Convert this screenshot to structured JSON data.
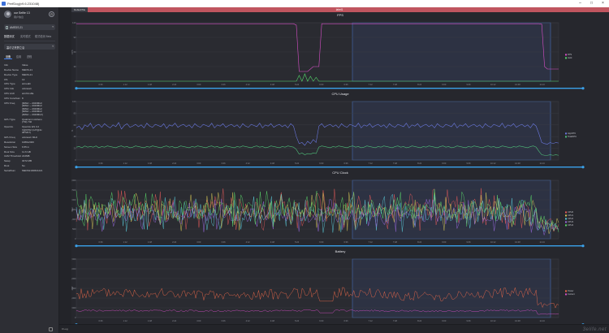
{
  "window": {
    "title": "PerfDog(v9.6.231048)"
  },
  "sidebar": {
    "username": "our Selfie 13",
    "usersub": "用户信息",
    "device": "AMEDS-21",
    "mode_tabs": [
      "数据测试",
      "实时模式",
      "模式检测 Beta"
    ],
    "app": "塞尔达荒野之息",
    "info_tabs": [
      "设备",
      "应用",
      "进程"
    ],
    "info_header": {
      "key": "Info",
      "value": "Value"
    },
    "info_rows": [
      {
        "k": "Device Name",
        "v": "MEDS-21"
      },
      {
        "k": "Device Type",
        "v": "MEDS-21"
      },
      {
        "k": "OS",
        "v": "13"
      },
      {
        "k": "CPU Type",
        "v": "armeabi"
      },
      {
        "k": "CPU Info",
        "v": "unknown"
      },
      {
        "k": "CPU Arch",
        "v": "arm64-v8a"
      },
      {
        "k": "CPU CoreNum",
        "v": "8"
      },
      {
        "k": "CPU Freq",
        "v": "[0MHz ~ 2040MHz\n[0MHz ~ 2040MHz\n[0MHz ~ 2040MHz\n[0MHz ~ 2040MHz\n[0MHz ~ 2040MHz]"
      },
      {
        "k": "GPU Type",
        "v": "Qualcomm Adreno\n(TM) 740"
      },
      {
        "k": "OpenGL",
        "v": "OpenGL ES 3.2\nV@0762 (GIT@4c\n0872b7)"
      },
      {
        "k": "GPU Freq",
        "v": "unknown MHz"
      },
      {
        "k": "Resolution",
        "v": "1080x2400"
      },
      {
        "k": "Screen Size",
        "v": "6.55 in"
      },
      {
        "k": "Root Size",
        "v": "11.6 GB"
      },
      {
        "k": "UAM Threshold",
        "v": "224MB"
      },
      {
        "k": "Swap",
        "v": "3072 MB"
      },
      {
        "k": "Root",
        "v": "No"
      },
      {
        "k": "SerialNum",
        "v": "MEDS2100821221"
      }
    ]
  },
  "main": {
    "header_left": "DefaultTile",
    "header_center": "label1"
  },
  "time_ticks": [
    "0:36",
    "1:12",
    "1:48",
    "2:24",
    "3:00",
    "3:36",
    "4:12",
    "4:48",
    "5:24",
    "6:00",
    "6:36",
    "7:12",
    "7:48",
    "8:24",
    "9:00",
    "9:36",
    "10:12",
    "10:48",
    "11:24",
    "12:00"
  ],
  "chart_data": [
    {
      "type": "line",
      "title": "FPS",
      "ylabel": "FPS",
      "ylim": [
        0,
        120
      ],
      "yticks": [
        "0",
        "30",
        "60",
        "90",
        "120"
      ],
      "grid": true,
      "legend": "right",
      "series": [
        {
          "name": "FPS",
          "color": "#d84fc8",
          "values": [
            118,
            118,
            118,
            118,
            118,
            118,
            118,
            118,
            118,
            118,
            118,
            118,
            118,
            118,
            118,
            118,
            118,
            118,
            118,
            118,
            118,
            118,
            118,
            118,
            118,
            118,
            118,
            118,
            118,
            118,
            118,
            118,
            118,
            118,
            118,
            118,
            118,
            118,
            118,
            118,
            118,
            118,
            118,
            118,
            118,
            118,
            118,
            118,
            118,
            118,
            118,
            118,
            118,
            118,
            118,
            118,
            118,
            118,
            118,
            118,
            118,
            118,
            118,
            118,
            118,
            118,
            118,
            118,
            118,
            118,
            118,
            118,
            118,
            118,
            118,
            118,
            118,
            118,
            115,
            20,
            20,
            20,
            20,
            25,
            30,
            30,
            30,
            118,
            118,
            118,
            118,
            118,
            118,
            118,
            118,
            118,
            118,
            118,
            118,
            118,
            118,
            118,
            118,
            118,
            118,
            118,
            118,
            118,
            118,
            118,
            118,
            118,
            118,
            118,
            118,
            118,
            118,
            118,
            118,
            118,
            118,
            118,
            118,
            118,
            118,
            118,
            118,
            118,
            118,
            118,
            118,
            118,
            118,
            118,
            118,
            118,
            118,
            118,
            118,
            118,
            118,
            118,
            118,
            118,
            118,
            118,
            118,
            118,
            118,
            118,
            118,
            118,
            118,
            118,
            118,
            118,
            118,
            118,
            118,
            118,
            118,
            118,
            118,
            118,
            118,
            117,
            30,
            25,
            25,
            25,
            25,
            25
          ]
        },
        {
          "name": "Jank",
          "color": "#53d66a",
          "values": [
            0,
            0,
            0,
            0,
            0,
            0,
            0,
            0,
            0,
            0,
            0,
            0,
            0,
            0,
            0,
            0,
            0,
            0,
            0,
            0,
            0,
            0,
            0,
            0,
            0,
            0,
            0,
            0,
            0,
            0,
            0,
            0,
            0,
            0,
            0,
            0,
            0,
            0,
            0,
            0,
            0,
            0,
            0,
            0,
            0,
            0,
            0,
            0,
            0,
            0,
            0,
            0,
            0,
            0,
            0,
            0,
            0,
            0,
            0,
            0,
            0,
            0,
            0,
            0,
            0,
            0,
            0,
            0,
            0,
            0,
            0,
            0,
            0,
            0,
            0,
            0,
            0,
            0,
            0,
            12,
            0,
            15,
            0,
            10,
            0,
            8,
            0,
            0,
            0,
            0,
            0,
            0,
            0,
            0,
            0,
            0,
            0,
            0,
            0,
            0,
            0,
            0,
            0,
            0,
            0,
            0,
            0,
            0,
            0,
            0,
            0,
            0,
            0,
            0,
            0,
            0,
            0,
            0,
            0,
            0,
            0,
            0,
            0,
            0,
            0,
            0,
            0,
            0,
            0,
            0,
            0,
            0,
            0,
            0,
            0,
            0,
            0,
            0,
            0,
            0,
            0,
            0,
            0,
            0,
            0,
            0,
            0,
            0,
            0,
            0,
            0,
            0,
            0,
            0,
            0,
            0,
            0,
            0,
            0,
            0,
            0,
            0,
            0,
            0,
            0,
            0,
            0,
            0,
            0,
            0,
            0,
            0
          ]
        }
      ]
    },
    {
      "type": "line",
      "title": "CPU Usage",
      "ylabel": "%",
      "ylim": [
        0,
        100
      ],
      "yticks": [
        "0",
        "20",
        "40",
        "60",
        "80",
        "100"
      ],
      "grid": true,
      "legend": "right",
      "series": [
        {
          "name": "AppCPU",
          "color": "#6a78e0",
          "values": [
            55,
            58,
            52,
            60,
            57,
            63,
            54,
            59,
            61,
            56,
            62,
            58,
            55,
            60,
            57,
            64,
            53,
            59,
            62,
            56,
            58,
            61,
            57,
            60,
            55,
            63,
            58,
            56,
            61,
            59,
            57,
            62,
            54,
            60,
            58,
            63,
            56,
            59,
            61,
            57,
            60,
            55,
            62,
            58,
            56,
            61,
            59,
            57,
            63,
            55,
            60,
            58,
            62,
            56,
            59,
            61,
            57,
            60,
            55,
            62,
            58,
            56,
            61,
            59,
            57,
            63,
            55,
            60,
            58,
            62,
            56,
            59,
            61,
            57,
            60,
            55,
            62,
            58,
            40,
            28,
            30,
            25,
            32,
            28,
            35,
            30,
            58,
            62,
            56,
            59,
            61,
            57,
            60,
            55,
            62,
            58,
            56,
            61,
            59,
            57,
            63,
            55,
            60,
            58,
            62,
            56,
            59,
            61,
            57,
            60,
            55,
            62,
            58,
            56,
            61,
            59,
            57,
            63,
            55,
            60,
            58,
            62,
            56,
            59,
            61,
            57,
            60,
            55,
            62,
            58,
            56,
            61,
            59,
            57,
            63,
            55,
            60,
            58,
            62,
            56,
            59,
            61,
            57,
            60,
            55,
            62,
            58,
            56,
            61,
            59,
            57,
            63,
            55,
            60,
            58,
            62,
            56,
            59,
            61,
            57,
            60,
            55,
            62,
            58,
            45,
            30,
            28,
            27,
            30,
            28,
            30,
            29
          ]
        },
        {
          "name": "TotalCPU",
          "color": "#4fbf7a",
          "values": [
            22,
            23,
            21,
            24,
            22,
            23,
            22,
            24,
            21,
            23,
            22,
            24,
            23,
            22,
            21,
            23,
            24,
            22,
            23,
            21,
            22,
            24,
            23,
            22,
            21,
            23,
            22,
            24,
            23,
            22,
            21,
            23,
            24,
            22,
            23,
            21,
            22,
            24,
            23,
            22,
            21,
            23,
            22,
            24,
            23,
            22,
            21,
            23,
            24,
            22,
            23,
            21,
            22,
            24,
            23,
            22,
            21,
            23,
            22,
            24,
            23,
            22,
            21,
            23,
            24,
            22,
            23,
            21,
            22,
            24,
            23,
            22,
            21,
            23,
            22,
            24,
            23,
            22,
            18,
            10,
            12,
            9,
            11,
            10,
            12,
            11,
            22,
            24,
            23,
            22,
            21,
            23,
            22,
            24,
            23,
            22,
            21,
            23,
            24,
            22,
            23,
            21,
            22,
            24,
            23,
            22,
            21,
            23,
            22,
            24,
            23,
            22,
            21,
            23,
            24,
            22,
            23,
            21,
            22,
            24,
            23,
            22,
            21,
            23,
            22,
            24,
            23,
            22,
            21,
            23,
            24,
            22,
            23,
            21,
            22,
            24,
            23,
            22,
            21,
            23,
            22,
            24,
            23,
            22,
            21,
            23,
            24,
            22,
            23,
            21,
            22,
            24,
            23,
            22,
            21,
            23,
            22,
            24,
            23,
            22,
            21,
            23,
            24,
            22,
            15,
            9,
            8,
            8,
            9,
            8,
            9,
            8
          ]
        }
      ]
    },
    {
      "type": "line",
      "title": "CPU Clock",
      "ylabel": "MHz",
      "ylim": [
        0,
        3000
      ],
      "yticks": [
        "0",
        "500",
        "1,000",
        "1,500",
        "2,000",
        "2,500",
        "3,000"
      ],
      "grid": true,
      "legend": "right",
      "series": [
        {
          "name": "CPU0",
          "color": "#e45a5a",
          "seed": 3,
          "base": 1500,
          "amp": 1100
        },
        {
          "name": "CPU1",
          "color": "#d8c957",
          "seed": 7,
          "base": 1400,
          "amp": 1000
        },
        {
          "name": "CPU2",
          "color": "#5ac9d8",
          "seed": 11,
          "base": 1300,
          "amp": 1000
        },
        {
          "name": "CPU3",
          "color": "#9a6ae0",
          "seed": 17,
          "base": 1200,
          "amp": 900
        },
        {
          "name": "CPU4",
          "color": "#5ad86a",
          "seed": 23,
          "base": 1600,
          "amp": 1000
        }
      ]
    },
    {
      "type": "line",
      "title": "Battery",
      "ylabel": "mW",
      "ylim": [
        0,
        12000
      ],
      "yticks": [
        "0",
        "2,000",
        "4,000",
        "6,000",
        "8,000",
        "10,000",
        "12,000"
      ],
      "grid": true,
      "legend": "right",
      "series": [
        {
          "name": "Power",
          "color": "#ee6a4a",
          "seed": 5,
          "base": 4800,
          "amp": 1800
        },
        {
          "name": "Current",
          "color": "#d84fc8",
          "seed": 9,
          "base": 1400,
          "amp": 300
        }
      ]
    }
  ],
  "statusbar": {
    "text": "0 Log"
  },
  "watermark": "3elife.net"
}
